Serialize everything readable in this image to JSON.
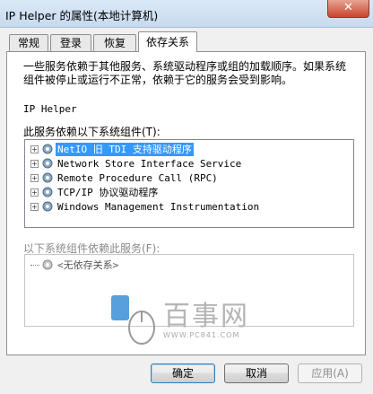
{
  "window": {
    "title": "IP Helper 的属性(本地计算机)",
    "close_glyph": "✕"
  },
  "tabs": [
    {
      "label": "常规",
      "active": false
    },
    {
      "label": "登录",
      "active": false
    },
    {
      "label": "恢复",
      "active": false
    },
    {
      "label": "依存关系",
      "active": true
    }
  ],
  "description": "一些服务依赖于其他服务、系统驱动程序或组的加载顺序。如果系统组件被停止或运行不正常，依赖于它的服务会受到影响。",
  "service_name": "IP Helper",
  "depends_on": {
    "label": "此服务依赖以下系统组件(T):",
    "items": [
      {
        "label": "NetIO 旧 TDI 支持驱动程序",
        "selected": true
      },
      {
        "label": "Network Store Interface Service",
        "selected": false
      },
      {
        "label": "Remote Procedure Call (RPC)",
        "selected": false
      },
      {
        "label": "TCP/IP 协议驱动程序",
        "selected": false
      },
      {
        "label": "Windows Management Instrumentation",
        "selected": false
      }
    ]
  },
  "dependents": {
    "label": "以下系统组件依赖此服务(F):",
    "items": [
      {
        "label": "<无依存关系>"
      }
    ]
  },
  "watermark": {
    "brand": "百事网",
    "url": "WWW.PC841.COM"
  },
  "buttons": {
    "ok": "确定",
    "cancel": "取消",
    "apply": "应用(A)"
  }
}
